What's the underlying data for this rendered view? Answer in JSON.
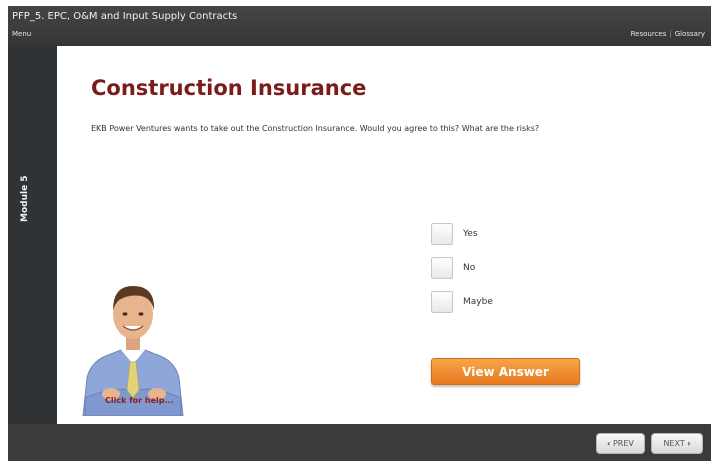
{
  "header": {
    "course_title": "PFP_5.  EPC, O&M and Input Supply Contracts",
    "menu": "Menu",
    "resources": "Resources",
    "separator": "|",
    "glossary": "Glossary"
  },
  "sidebar": {
    "module_label": "Module 5"
  },
  "main": {
    "title": "Construction Insurance",
    "question": "EKB Power Ventures wants to take out the Construction Insurance. Would you agree to this? What are the risks?",
    "options": [
      {
        "label": "Yes",
        "checked": false
      },
      {
        "label": "No",
        "checked": false
      },
      {
        "label": "Maybe",
        "checked": false
      }
    ],
    "view_answer_label": "View Answer",
    "help_text": "Click for help..."
  },
  "footer": {
    "prev_label": "PREV",
    "next_label": "NEXT",
    "prev_icon": "chevron-left-icon",
    "next_icon": "chevron-right-icon"
  },
  "colors": {
    "title": "#7b1b1b",
    "accent_button": "#f39a3f",
    "chrome": "#3b3b3b"
  }
}
